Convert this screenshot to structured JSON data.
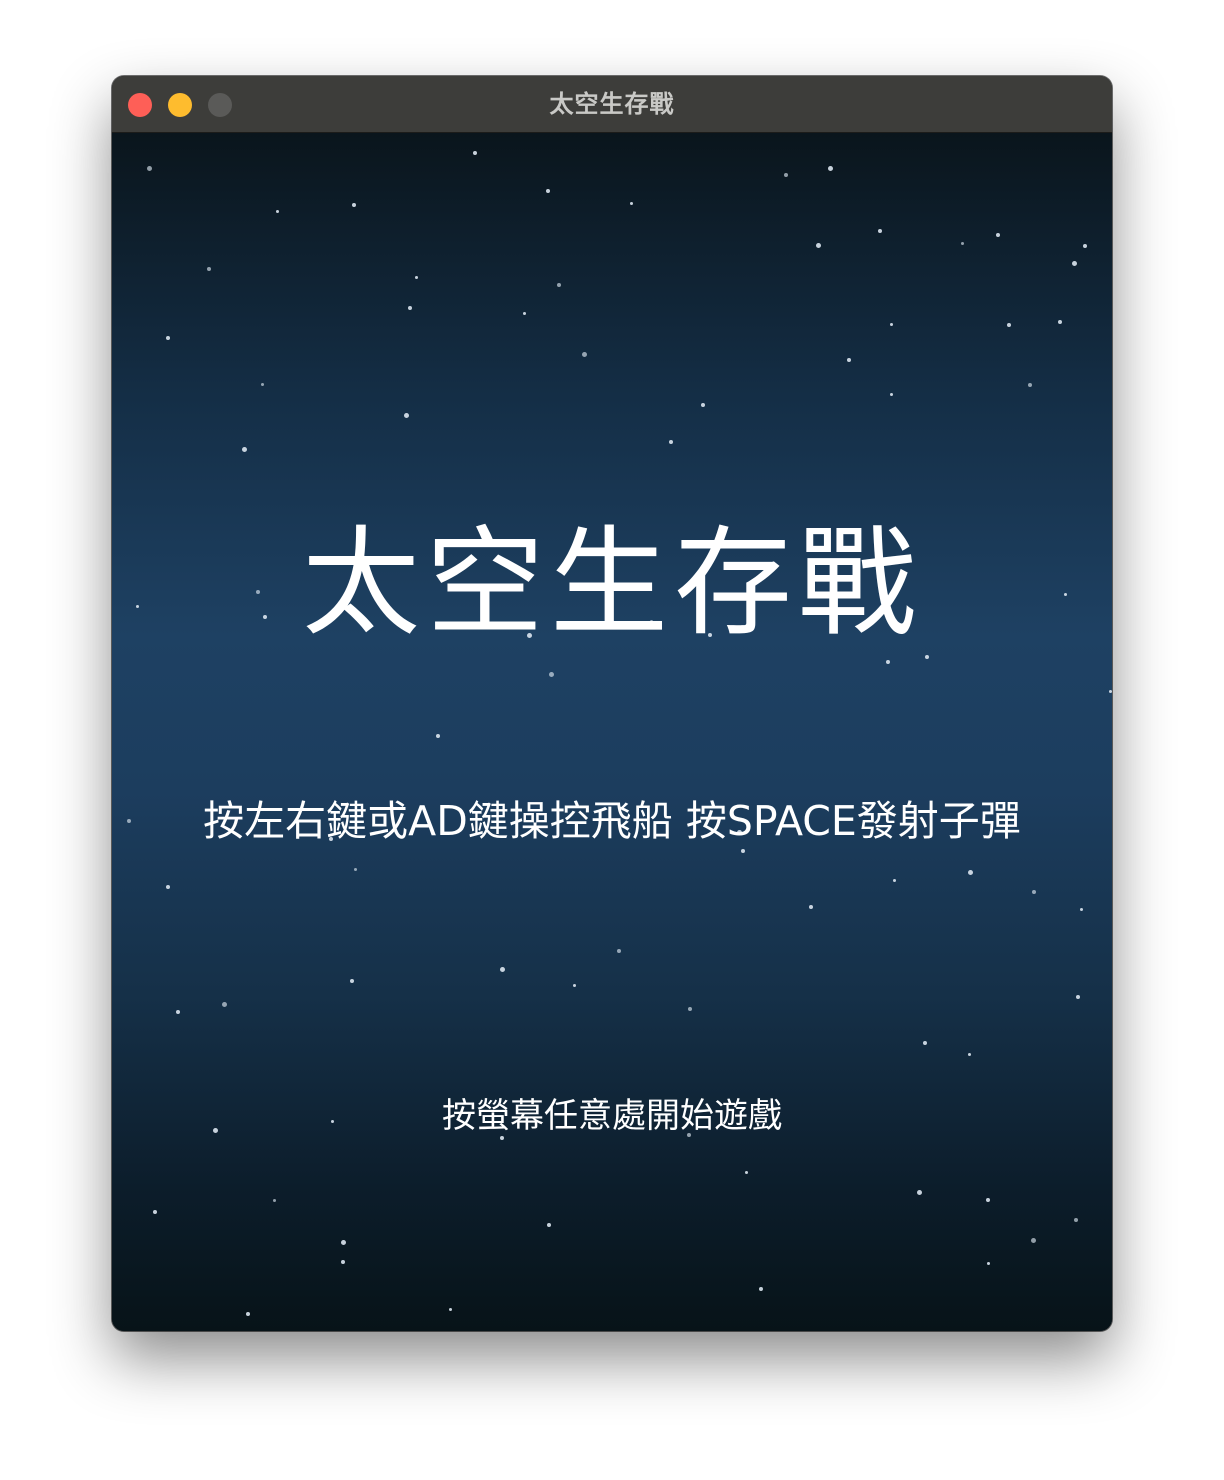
{
  "window": {
    "title": "太空生存戰",
    "traffic_lights": {
      "close_color": "#fe5f57",
      "minimize_color": "#febc2e",
      "zoom_color": "#5a5a58"
    }
  },
  "game": {
    "title": "太空生存戰",
    "instructions": "按左右鍵或AD鍵操控飛船 按SPACE發射子彈",
    "start_prompt": "按螢幕任意處開始遊戲"
  },
  "colors": {
    "space_top": "#0a151c",
    "space_middle": "#1e4163",
    "space_bottom": "#071318",
    "text": "#ffffff",
    "star": "#dbe6f0"
  }
}
